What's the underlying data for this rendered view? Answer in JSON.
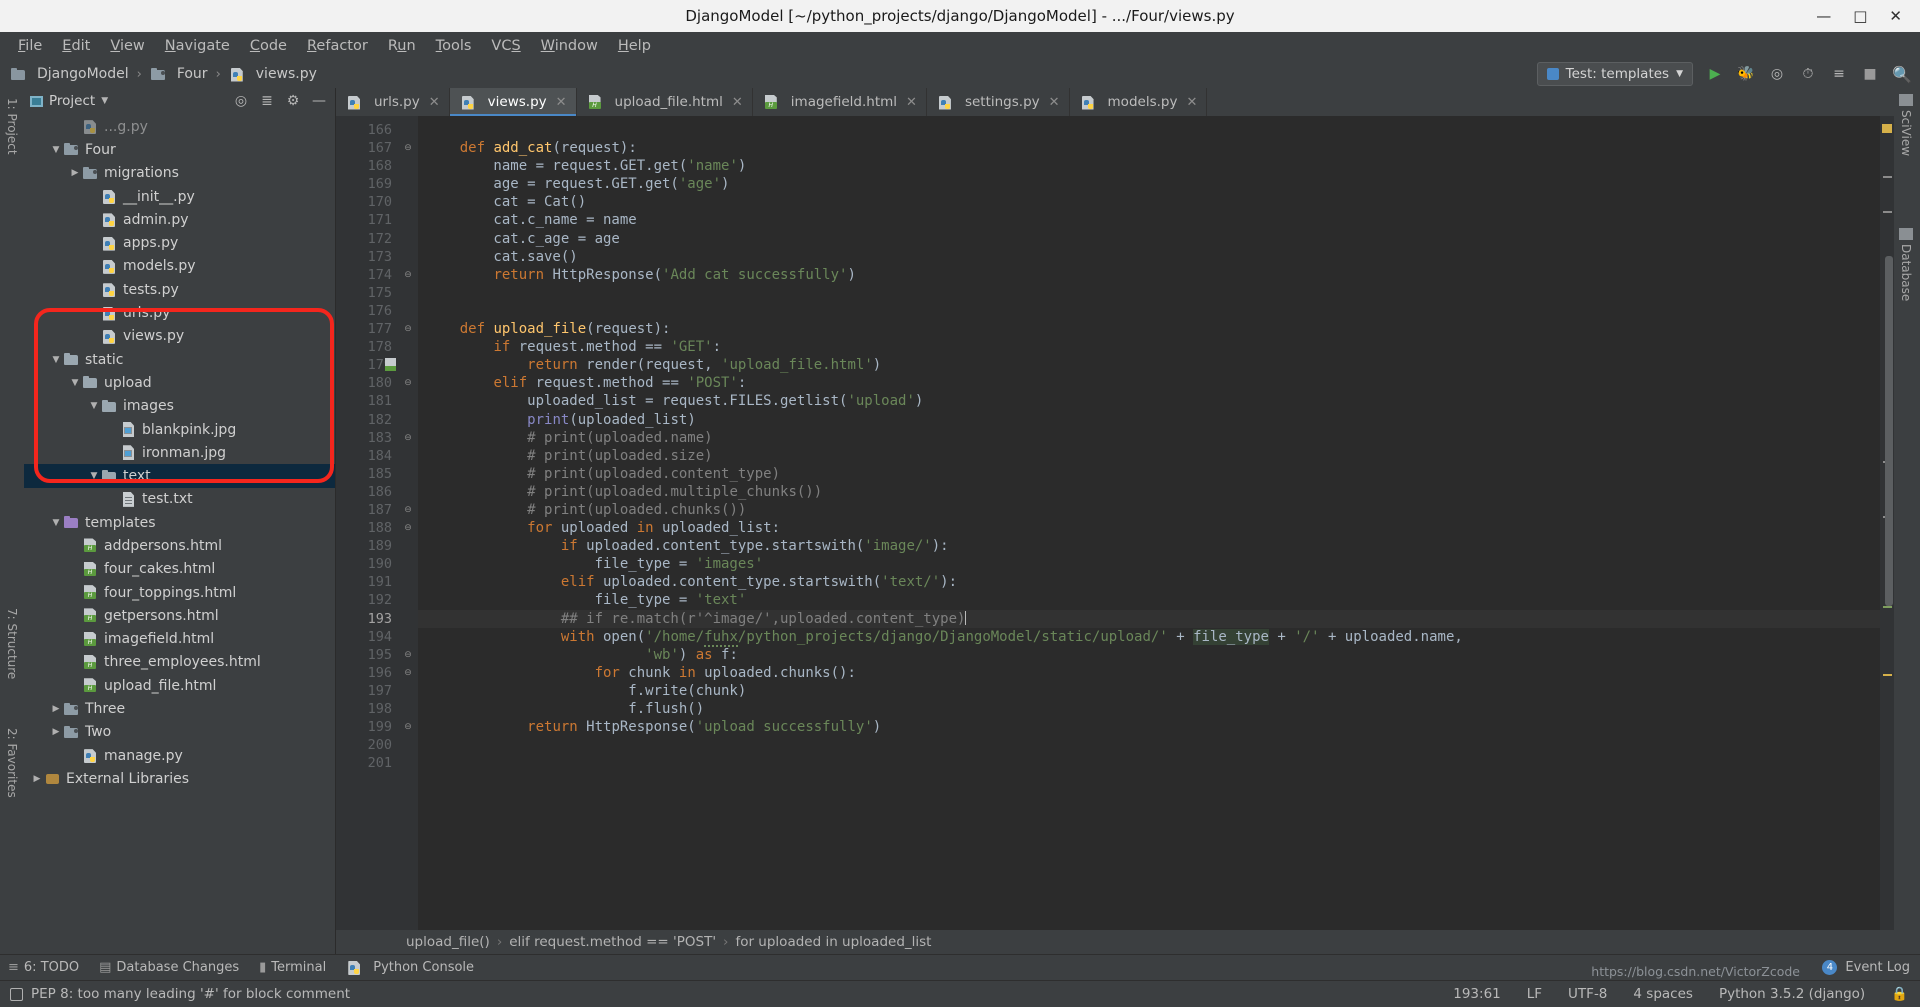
{
  "window": {
    "title": "DjangoModel [~/python_projects/django/DjangoModel] - .../Four/views.py",
    "minimize": "—",
    "maximize": "□",
    "close": "✕"
  },
  "menu": [
    {
      "label": "File"
    },
    {
      "label": "Edit"
    },
    {
      "label": "View"
    },
    {
      "label": "Navigate"
    },
    {
      "label": "Code"
    },
    {
      "label": "Refactor"
    },
    {
      "label": "Run"
    },
    {
      "label": "Tools"
    },
    {
      "label": "VCS"
    },
    {
      "label": "Window"
    },
    {
      "label": "Help"
    }
  ],
  "breadcrumb": {
    "items": [
      "DjangoModel",
      "Four",
      "views.py"
    ],
    "separator": "›"
  },
  "toolbar": {
    "run_config": "Test: templates",
    "run_config_icon": "run-config-icon",
    "dropdown_icon": "chevron-down-icon",
    "icons": [
      "run-icon",
      "debug-icon",
      "coverage-icon",
      "profile-icon",
      "attach-icon",
      "stop-icon",
      "search-icon"
    ]
  },
  "left_strips": {
    "top": "1: Project",
    "middle": "7: Structure",
    "bottom": "2: Favorites"
  },
  "right_strips": {
    "sciview": "SciView",
    "database": "Database"
  },
  "project_panel": {
    "title": "Project",
    "dropdown_icon": "chevron-down-icon",
    "header_icons": [
      "locate-icon",
      "collapse-all-icon",
      "settings-icon",
      "hide-icon"
    ],
    "tree": [
      {
        "label": "...g.py",
        "indent": 2,
        "icon": "python",
        "arrow": "",
        "partial": true
      },
      {
        "label": "Four",
        "indent": 1,
        "icon": "folder-mod",
        "arrow": "▼"
      },
      {
        "label": "migrations",
        "indent": 2,
        "icon": "folder-mod",
        "arrow": "▶"
      },
      {
        "label": "__init__.py",
        "indent": 3,
        "icon": "python",
        "arrow": ""
      },
      {
        "label": "admin.py",
        "indent": 3,
        "icon": "python",
        "arrow": ""
      },
      {
        "label": "apps.py",
        "indent": 3,
        "icon": "python",
        "arrow": ""
      },
      {
        "label": "models.py",
        "indent": 3,
        "icon": "python",
        "arrow": ""
      },
      {
        "label": "tests.py",
        "indent": 3,
        "icon": "python",
        "arrow": ""
      },
      {
        "label": "urls.py",
        "indent": 3,
        "icon": "python",
        "arrow": ""
      },
      {
        "label": "views.py",
        "indent": 3,
        "icon": "python",
        "arrow": ""
      },
      {
        "label": "static",
        "indent": 1,
        "icon": "folder",
        "arrow": "▼"
      },
      {
        "label": "upload",
        "indent": 2,
        "icon": "folder",
        "arrow": "▼"
      },
      {
        "label": "images",
        "indent": 3,
        "icon": "folder",
        "arrow": "▼"
      },
      {
        "label": "blankpink.jpg",
        "indent": 4,
        "icon": "image",
        "arrow": ""
      },
      {
        "label": "ironman.jpg",
        "indent": 4,
        "icon": "image",
        "arrow": ""
      },
      {
        "label": "text",
        "indent": 3,
        "icon": "folder",
        "arrow": "▼",
        "selected": true
      },
      {
        "label": "test.txt",
        "indent": 4,
        "icon": "txt",
        "arrow": ""
      },
      {
        "label": "templates",
        "indent": 1,
        "icon": "folder-purple",
        "arrow": "▼"
      },
      {
        "label": "addpersons.html",
        "indent": 2,
        "icon": "html",
        "arrow": ""
      },
      {
        "label": "four_cakes.html",
        "indent": 2,
        "icon": "html",
        "arrow": ""
      },
      {
        "label": "four_toppings.html",
        "indent": 2,
        "icon": "html",
        "arrow": ""
      },
      {
        "label": "getpersons.html",
        "indent": 2,
        "icon": "html",
        "arrow": ""
      },
      {
        "label": "imagefield.html",
        "indent": 2,
        "icon": "html",
        "arrow": ""
      },
      {
        "label": "three_employees.html",
        "indent": 2,
        "icon": "html",
        "arrow": ""
      },
      {
        "label": "upload_file.html",
        "indent": 2,
        "icon": "html",
        "arrow": ""
      },
      {
        "label": "Three",
        "indent": 1,
        "icon": "folder-mod",
        "arrow": "▶"
      },
      {
        "label": "Two",
        "indent": 1,
        "icon": "folder-mod",
        "arrow": "▶"
      },
      {
        "label": "manage.py",
        "indent": 2,
        "icon": "python",
        "arrow": ""
      },
      {
        "label": "External Libraries",
        "indent": 0,
        "icon": "lib",
        "arrow": "▶"
      }
    ]
  },
  "editor": {
    "tabs": [
      {
        "label": "urls.py",
        "icon": "python",
        "active": false,
        "close": "✕"
      },
      {
        "label": "views.py",
        "icon": "python",
        "active": true,
        "close": "✕"
      },
      {
        "label": "upload_file.html",
        "icon": "html",
        "active": false,
        "close": "✕"
      },
      {
        "label": "imagefield.html",
        "icon": "html",
        "active": false,
        "close": "✕"
      },
      {
        "label": "settings.py",
        "icon": "python",
        "active": false,
        "close": "✕"
      },
      {
        "label": "models.py",
        "icon": "python",
        "active": false,
        "close": "✕"
      }
    ],
    "first_line": 166,
    "lines": [
      {
        "n": 166,
        "text": ""
      },
      {
        "n": 167,
        "text": "    def add_cat(request):",
        "fold": "⊖"
      },
      {
        "n": 168,
        "text": "        name = request.GET.get('name')"
      },
      {
        "n": 169,
        "text": "        age = request.GET.get('age')"
      },
      {
        "n": 170,
        "text": "        cat = Cat()"
      },
      {
        "n": 171,
        "text": "        cat.c_name = name"
      },
      {
        "n": 172,
        "text": "        cat.c_age = age"
      },
      {
        "n": 173,
        "text": "        cat.save()"
      },
      {
        "n": 174,
        "text": "        return HttpResponse('Add cat successfully')",
        "fold": "⊖"
      },
      {
        "n": 175,
        "text": ""
      },
      {
        "n": 176,
        "text": ""
      },
      {
        "n": 177,
        "text": "    def upload_file(request):",
        "fold": "⊖"
      },
      {
        "n": 178,
        "text": "        if request.method == 'GET':"
      },
      {
        "n": 179,
        "text": "            return render(request, 'upload_file.html')",
        "gutter_icon": "html"
      },
      {
        "n": 180,
        "text": "        elif request.method == 'POST':",
        "fold": "⊖"
      },
      {
        "n": 181,
        "text": "            uploaded_list = request.FILES.getlist('upload')"
      },
      {
        "n": 182,
        "text": "            print(uploaded_list)"
      },
      {
        "n": 183,
        "text": "            # print(uploaded.name)",
        "fold": "⊖"
      },
      {
        "n": 184,
        "text": "            # print(uploaded.size)"
      },
      {
        "n": 185,
        "text": "            # print(uploaded.content_type)"
      },
      {
        "n": 186,
        "text": "            # print(uploaded.multiple_chunks())"
      },
      {
        "n": 187,
        "text": "            # print(uploaded.chunks())",
        "fold": "⊖"
      },
      {
        "n": 188,
        "text": "            for uploaded in uploaded_list:",
        "fold": "⊖"
      },
      {
        "n": 189,
        "text": "                if uploaded.content_type.startswith('image/'):"
      },
      {
        "n": 190,
        "text": "                    file_type = 'images'"
      },
      {
        "n": 191,
        "text": "                elif uploaded.content_type.startswith('text/'):"
      },
      {
        "n": 192,
        "text": "                    file_type = 'text'"
      },
      {
        "n": 193,
        "text": "                ## if re.match(r'^image/',uploaded.content_type)",
        "current": true
      },
      {
        "n": 194,
        "text": "                with open('/home/fuhx/python_projects/django/DjangoModel/static/upload/' + file_type + '/' + uploaded.name,"
      },
      {
        "n": 195,
        "text": "                          'wb') as f:",
        "fold": "⊖"
      },
      {
        "n": 196,
        "text": "                    for chunk in uploaded.chunks():",
        "fold": "⊖"
      },
      {
        "n": 197,
        "text": "                        f.write(chunk)"
      },
      {
        "n": 198,
        "text": "                        f.flush()"
      },
      {
        "n": 199,
        "text": "            return HttpResponse('upload successfully')",
        "fold": "⊖"
      },
      {
        "n": 200,
        "text": ""
      },
      {
        "n": 201,
        "text": ""
      }
    ],
    "breadcrumb": [
      "upload_file()",
      "elif request.method == 'POST'",
      "for uploaded in uploaded_list"
    ],
    "breadcrumb_separator": "›"
  },
  "bottom_bar": {
    "items": [
      {
        "label": "6: TODO",
        "icon": "todo-icon"
      },
      {
        "label": "Database Changes",
        "icon": "database-changes-icon"
      },
      {
        "label": "Terminal",
        "icon": "terminal-icon"
      },
      {
        "label": "Python Console",
        "icon": "python-console-icon"
      }
    ],
    "event_log": "Event Log",
    "event_count": "4"
  },
  "status_bar": {
    "message": "PEP 8: too many leading '#' for block comment",
    "caret": "193:61",
    "line_separator": "LF",
    "encoding": "UTF-8",
    "indent": "4 spaces",
    "interpreter": "Python 3.5.2 (django)"
  },
  "watermark": "https://blog.csdn.net/VictorZcode",
  "colors": {
    "accent": "#4a88c7",
    "annotation_red": "#f4261d",
    "selection": "#0d293e",
    "editor_bg": "#2b2b2b",
    "panel_bg": "#3c3f41"
  }
}
